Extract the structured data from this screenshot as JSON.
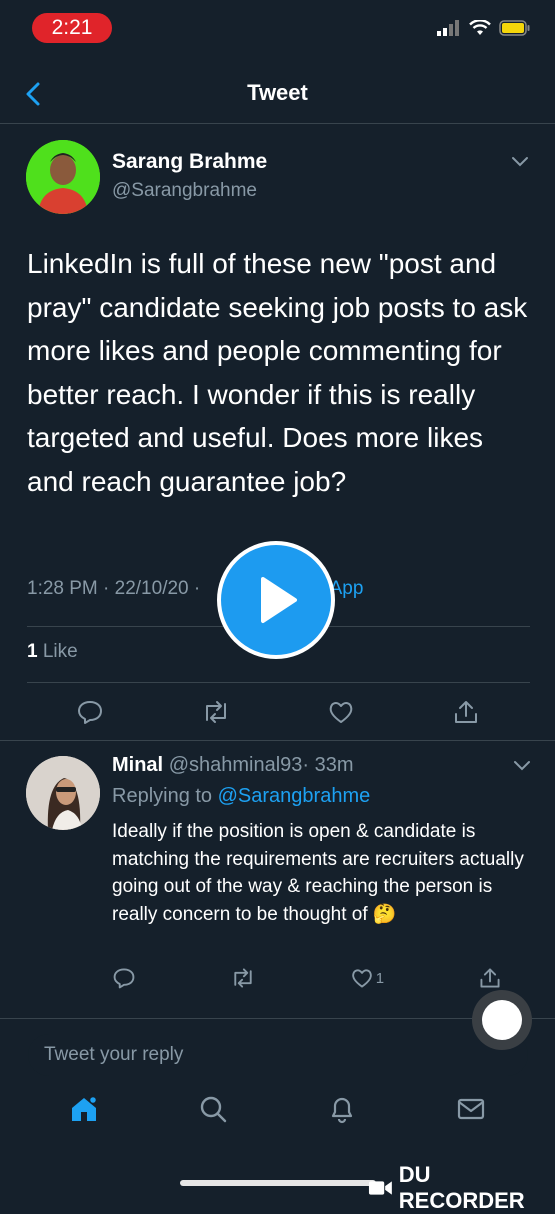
{
  "status_bar": {
    "time": "2:21"
  },
  "nav": {
    "title": "Tweet"
  },
  "tweet": {
    "author_name": "Sarang Brahme",
    "author_handle": "@Sarangbrahme",
    "text": "LinkedIn is full of these new \"post and pray\" candidate seeking job posts to ask more likes and people commenting for better reach. I wonder if this is really targeted and useful. Does more likes and reach guarantee job?",
    "timestamp": "1:28 PM · 22/10/20 ·",
    "source_partial": "p App",
    "like_count": "1",
    "like_label": "Like"
  },
  "reply": {
    "author_name": "Minal",
    "author_handle": "@shahminal93",
    "age": "· 33m",
    "replying_to_label": "Replying to",
    "replying_to_handle": "@Sarangbrahme",
    "text": "Ideally if the position is open & candidate is matching the requirements are recruiters actually going out of the way & reaching the person is really concern to be thought of",
    "emoji": "🤔",
    "like_count": "1"
  },
  "composer": {
    "placeholder": "Tweet your reply"
  },
  "overlay": {
    "recorder_label": "DU RECORDER"
  },
  "colors": {
    "accent": "#1da1f2",
    "background": "#15202b",
    "muted": "#8899a6",
    "status_pill": "#e0242a"
  },
  "icons": [
    "back-chevron-icon",
    "chevron-down-icon",
    "reply-icon",
    "retweet-icon",
    "like-icon",
    "share-icon",
    "play-icon",
    "home-icon",
    "search-icon",
    "notifications-icon",
    "messages-icon"
  ]
}
